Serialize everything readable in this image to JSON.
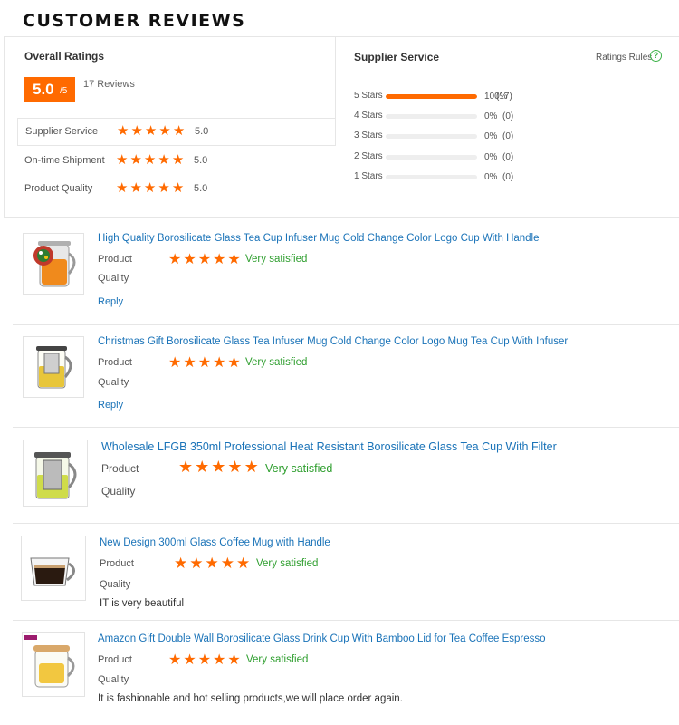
{
  "header": {
    "title": "CUSTOMER REVIEWS"
  },
  "overall": {
    "title": "Overall Ratings",
    "score": "5.0",
    "score_max": "/5",
    "review_count": "17 Reviews",
    "metrics": [
      {
        "label": "Supplier Service",
        "value": "5.0"
      },
      {
        "label": "On-time Shipment",
        "value": "5.0"
      },
      {
        "label": "Product Quality",
        "value": "5.0"
      }
    ]
  },
  "supplier": {
    "title": "Supplier Service",
    "rules_label": "Ratings Rules",
    "help_icon": "question-circle-icon",
    "distribution": [
      {
        "label": "5 Stars",
        "pct": "100%",
        "count": "(17)",
        "fraction": 1.0
      },
      {
        "label": "4 Stars",
        "pct": "0%",
        "count": "(0)",
        "fraction": 0
      },
      {
        "label": "3 Stars",
        "pct": "0%",
        "count": "(0)",
        "fraction": 0
      },
      {
        "label": "2 Stars",
        "pct": "0%",
        "count": "(0)",
        "fraction": 0
      },
      {
        "label": "1 Stars",
        "pct": "0%",
        "count": "(0)",
        "fraction": 0
      }
    ]
  },
  "reviews": [
    {
      "title": "High Quality Borosilicate Glass Tea Cup Infuser Mug Cold Change Color Logo Cup With Handle",
      "product_label": "Product",
      "quality_label": "Quality",
      "rating": 5,
      "rating_text": "Very satisfied",
      "reply": "Reply",
      "comment": ""
    },
    {
      "title": "Christmas Gift Borosilicate Glass Tea Infuser Mug Cold Change Color Logo Mug Tea Cup With Infuser",
      "product_label": "Product",
      "quality_label": "Quality",
      "rating": 5,
      "rating_text": "Very satisfied",
      "reply": "Reply",
      "comment": ""
    },
    {
      "title": "Wholesale LFGB 350ml Professional Heat Resistant Borosilicate Glass Tea Cup With Filter",
      "product_label": "Product",
      "quality_label": "Quality",
      "rating": 5,
      "rating_text": "Very satisfied",
      "reply": "",
      "comment": ""
    },
    {
      "title": "New Design 300ml Glass Coffee Mug with Handle",
      "product_label": "Product",
      "quality_label": "Quality",
      "rating": 5,
      "rating_text": "Very satisfied",
      "reply": "",
      "comment": "IT is very beautiful"
    },
    {
      "title": "Amazon Gift Double Wall Borosilicate Glass Drink Cup With Bamboo Lid for Tea Coffee Espresso",
      "product_label": "Product",
      "quality_label": "Quality",
      "rating": 5,
      "rating_text": "Very satisfied",
      "reply": "",
      "comment": "It is fashionable and hot selling products,we will place order again."
    }
  ],
  "colors": {
    "accent": "#ff6a00",
    "link": "#1a73b8",
    "positive": "#2e9e2e"
  }
}
